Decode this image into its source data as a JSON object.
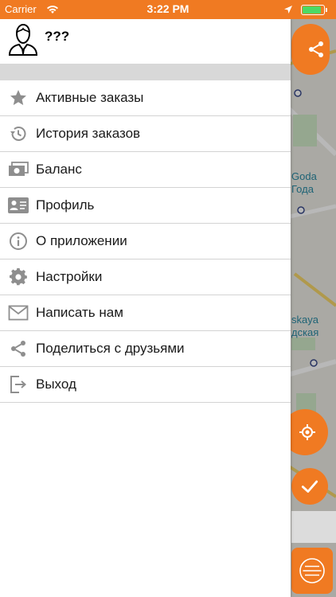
{
  "status_bar": {
    "carrier": "Carrier",
    "time": "3:22 PM"
  },
  "user": {
    "name": "???"
  },
  "menu": [
    {
      "label": "Активные заказы",
      "icon": "star-icon"
    },
    {
      "label": "История заказов",
      "icon": "history-icon"
    },
    {
      "label": "Баланс",
      "icon": "money-icon"
    },
    {
      "label": "Профиль",
      "icon": "profile-card-icon"
    },
    {
      "label": "О приложении",
      "icon": "info-icon"
    },
    {
      "label": "Настройки",
      "icon": "gear-icon"
    },
    {
      "label": "Написать нам",
      "icon": "mail-icon"
    },
    {
      "label": "Поделиться с друзьями",
      "icon": "share-icon"
    },
    {
      "label": "Выход",
      "icon": "logout-icon"
    }
  ],
  "map": {
    "labels": [
      "Goda",
      "Года",
      "skaya",
      "дская"
    ]
  },
  "colors": {
    "accent": "#f07a22",
    "icon_gray": "#8e8e8e",
    "separator": "#d8d8d8"
  }
}
